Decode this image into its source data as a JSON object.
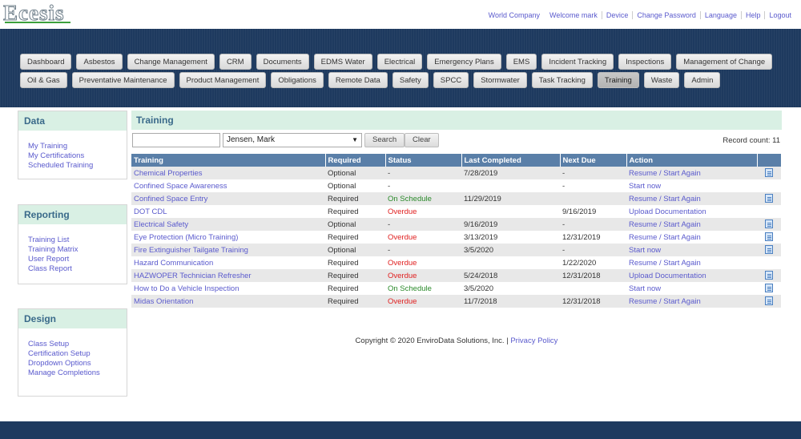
{
  "app": {
    "logo": "Ecesis"
  },
  "toplinks": [
    "World Company",
    "Welcome mark",
    "Device",
    "Change Password",
    "Language",
    "Help",
    "Logout"
  ],
  "nav": {
    "row1": [
      "Dashboard",
      "Asbestos",
      "Change Management",
      "CRM",
      "Documents",
      "EDMS Water",
      "Electrical",
      "Emergency Plans",
      "EMS",
      "Incident Tracking",
      "Inspections",
      "Management of Change"
    ],
    "row2": [
      "Oil & Gas",
      "Preventative Maintenance",
      "Product Management",
      "Obligations",
      "Remote Data",
      "Safety",
      "SPCC",
      "Stormwater",
      "Task Tracking",
      "Training",
      "Waste",
      "Admin"
    ],
    "active": "Training"
  },
  "sidebar": {
    "data": {
      "title": "Data",
      "items": [
        "My Training",
        "My Certifications",
        "Scheduled Training"
      ]
    },
    "reporting": {
      "title": "Reporting",
      "items": [
        "Training List",
        "Training Matrix",
        "User Report",
        "Class Report"
      ]
    },
    "design": {
      "title": "Design",
      "items": [
        "Class Setup",
        "Certification Setup",
        "Dropdown Options",
        "Manage Completions"
      ]
    }
  },
  "main": {
    "title": "Training",
    "search_value": "",
    "employee": "Jensen, Mark",
    "search_label": "Search",
    "clear_label": "Clear",
    "record_count": "Record count: 11",
    "columns": [
      "Training",
      "Required",
      "Status",
      "Last Completed",
      "Next Due",
      "Action",
      ""
    ],
    "rows": [
      {
        "training": "Chemical Properties",
        "required": "Optional",
        "status": "-",
        "status_kind": "plain",
        "last": "7/28/2019",
        "next": "-",
        "action": "Resume / Start Again",
        "doc": true
      },
      {
        "training": "Confined Space Awareness",
        "required": "Optional",
        "status": "-",
        "status_kind": "plain",
        "last": "",
        "next": "-",
        "action": "Start now",
        "doc": false
      },
      {
        "training": "Confined Space Entry",
        "required": "Required",
        "status": "On Schedule",
        "status_kind": "ok",
        "last": "11/29/2019",
        "next": "",
        "action": "Resume / Start Again",
        "doc": true
      },
      {
        "training": "DOT CDL",
        "required": "Required",
        "status": "Overdue",
        "status_kind": "bad",
        "last": "",
        "next": "9/16/2019",
        "action": "Upload Documentation",
        "doc": false
      },
      {
        "training": "Electrical Safety",
        "required": "Optional",
        "status": "-",
        "status_kind": "plain",
        "last": "9/16/2019",
        "next": "-",
        "action": "Resume / Start Again",
        "doc": true
      },
      {
        "training": "Eye Protection (Micro Training)",
        "required": "Required",
        "status": "Overdue",
        "status_kind": "bad",
        "last": "3/13/2019",
        "next": "12/31/2019",
        "action": "Resume / Start Again",
        "doc": true
      },
      {
        "training": "Fire Extinguisher Tailgate Training",
        "required": "Optional",
        "status": "-",
        "status_kind": "plain",
        "last": "3/5/2020",
        "next": "-",
        "action": "Start now",
        "doc": true
      },
      {
        "training": "Hazard Communication",
        "required": "Required",
        "status": "Overdue",
        "status_kind": "bad",
        "last": "",
        "next": "1/22/2020",
        "action": "Resume / Start Again",
        "doc": false
      },
      {
        "training": "HAZWOPER Technician Refresher",
        "required": "Required",
        "status": "Overdue",
        "status_kind": "bad",
        "last": "5/24/2018",
        "next": "12/31/2018",
        "action": "Upload Documentation",
        "doc": true
      },
      {
        "training": "How to Do a Vehicle Inspection",
        "required": "Required",
        "status": "On Schedule",
        "status_kind": "ok",
        "last": "3/5/2020",
        "next": "",
        "action": "Start now",
        "doc": true
      },
      {
        "training": "Midas Orientation",
        "required": "Required",
        "status": "Overdue",
        "status_kind": "bad",
        "last": "11/7/2018",
        "next": "12/31/2018",
        "action": "Resume / Start Again",
        "doc": true
      }
    ]
  },
  "footer": {
    "copyright": "Copyright © 2020 EnviroData Solutions, Inc. |",
    "privacy": "Privacy Policy"
  },
  "colors": {
    "nav_band": "#1e3a5f",
    "header_bg": "#d9f0e4",
    "table_header": "#5a7fa8",
    "link": "#5a5acd",
    "overdue": "#e02020",
    "on_schedule": "#2a8a2a"
  }
}
